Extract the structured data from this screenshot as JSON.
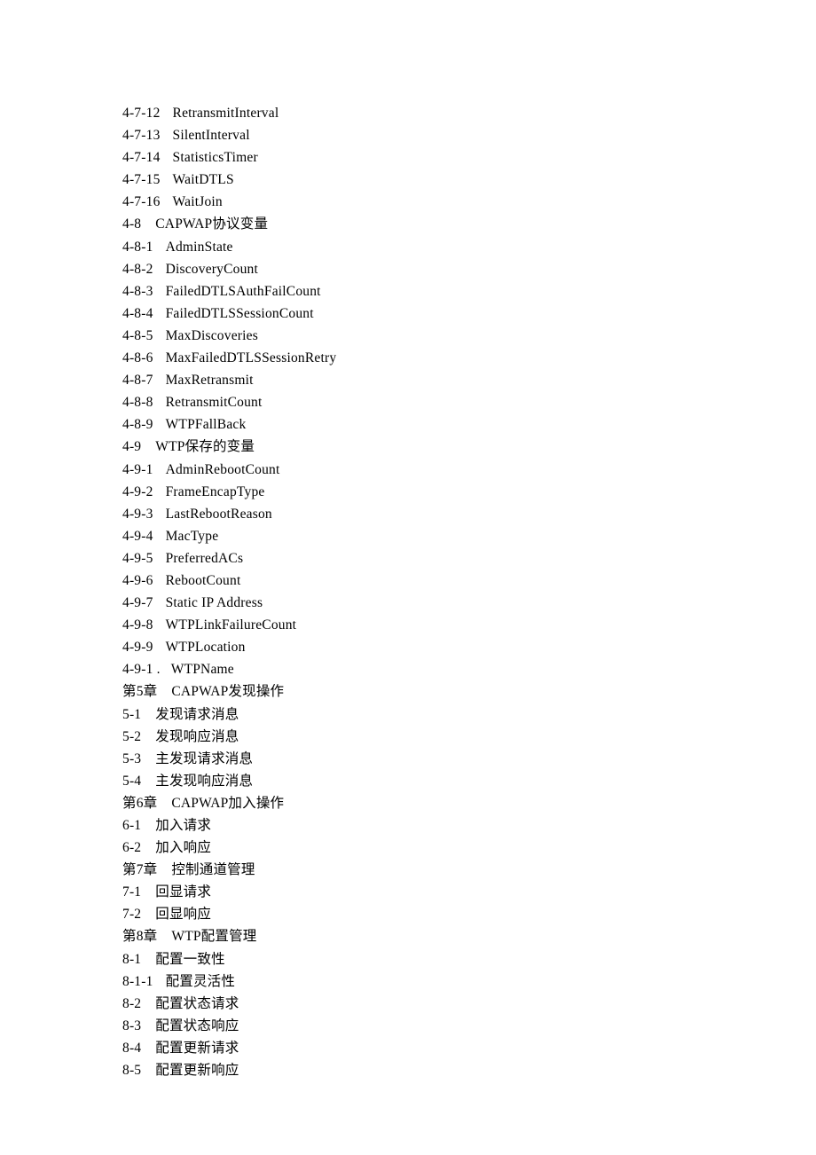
{
  "lines": [
    {
      "num": "4-7-12",
      "title": "RetransmitInterval",
      "indent": 1
    },
    {
      "num": "4-7-13",
      "title": "SilentInterval",
      "indent": 1
    },
    {
      "num": "4-7-14",
      "title": "StatisticsTimer",
      "indent": 1
    },
    {
      "num": "4-7-15",
      "title": "WaitDTLS",
      "indent": 1
    },
    {
      "num": "4-7-16",
      "title": "WaitJoin",
      "indent": 1
    },
    {
      "num": "4-8",
      "title": "CAPWAP协议变量",
      "indent": 0
    },
    {
      "num": "4-8-1",
      "title": "AdminState",
      "indent": 1
    },
    {
      "num": "4-8-2",
      "title": "DiscoveryCount",
      "indent": 1
    },
    {
      "num": "4-8-3",
      "title": "FailedDTLSAuthFailCount",
      "indent": 1
    },
    {
      "num": "4-8-4",
      "title": "FailedDTLSSessionCount",
      "indent": 1
    },
    {
      "num": "4-8-5",
      "title": "MaxDiscoveries",
      "indent": 1
    },
    {
      "num": "4-8-6",
      "title": "MaxFailedDTLSSessionRetry",
      "indent": 1
    },
    {
      "num": "4-8-7",
      "title": "MaxRetransmit",
      "indent": 1
    },
    {
      "num": "4-8-8",
      "title": "RetransmitCount",
      "indent": 1
    },
    {
      "num": "4-8-9",
      "title": "WTPFallBack",
      "indent": 1
    },
    {
      "num": "4-9",
      "title": "WTP保存的变量",
      "indent": 0
    },
    {
      "num": "4-9-1",
      "title": "AdminRebootCount",
      "indent": 1
    },
    {
      "num": "4-9-2",
      "title": "FrameEncapType",
      "indent": 1
    },
    {
      "num": "4-9-3",
      "title": "LastRebootReason",
      "indent": 1
    },
    {
      "num": "4-9-4",
      "title": "MacType",
      "indent": 1
    },
    {
      "num": "4-9-5",
      "title": "PreferredACs",
      "indent": 1
    },
    {
      "num": "4-9-6",
      "title": "RebootCount",
      "indent": 1
    },
    {
      "num": "4-9-7",
      "title": "Static IP Address",
      "indent": 1
    },
    {
      "num": "4-9-8",
      "title": "WTPLinkFailureCount",
      "indent": 1
    },
    {
      "num": "4-9-9",
      "title": "WTPLocation",
      "indent": 1
    },
    {
      "num": "4-9-1 .",
      "title": "WTPName",
      "indent": 2
    },
    {
      "num": "第5章",
      "title": "CAPWAP发现操作",
      "indent": 0
    },
    {
      "num": "5-1",
      "title": "发现请求消息",
      "indent": 0
    },
    {
      "num": "5-2",
      "title": "发现响应消息",
      "indent": 0
    },
    {
      "num": "5-3",
      "title": "主发现请求消息",
      "indent": 0
    },
    {
      "num": "5-4",
      "title": "主发现响应消息",
      "indent": 0
    },
    {
      "num": "第6章",
      "title": "CAPWAP加入操作",
      "indent": 0
    },
    {
      "num": "6-1",
      "title": "加入请求",
      "indent": 0
    },
    {
      "num": "6-2",
      "title": "加入响应",
      "indent": 0
    },
    {
      "num": "第7章",
      "title": "控制通道管理",
      "indent": 0
    },
    {
      "num": "7-1",
      "title": "回显请求",
      "indent": 0
    },
    {
      "num": "7-2",
      "title": "回显响应",
      "indent": 0
    },
    {
      "num": "第8章",
      "title": "WTP配置管理",
      "indent": 0
    },
    {
      "num": "8-1",
      "title": "配置一致性",
      "indent": 0
    },
    {
      "num": "8-1-1",
      "title": "配置灵活性",
      "indent": 1
    },
    {
      "num": "8-2",
      "title": "配置状态请求",
      "indent": 0
    },
    {
      "num": "8-3",
      "title": "配置状态响应",
      "indent": 0
    },
    {
      "num": "8-4",
      "title": "配置更新请求",
      "indent": 0
    },
    {
      "num": "8-5",
      "title": "配置更新响应",
      "indent": 0
    }
  ]
}
